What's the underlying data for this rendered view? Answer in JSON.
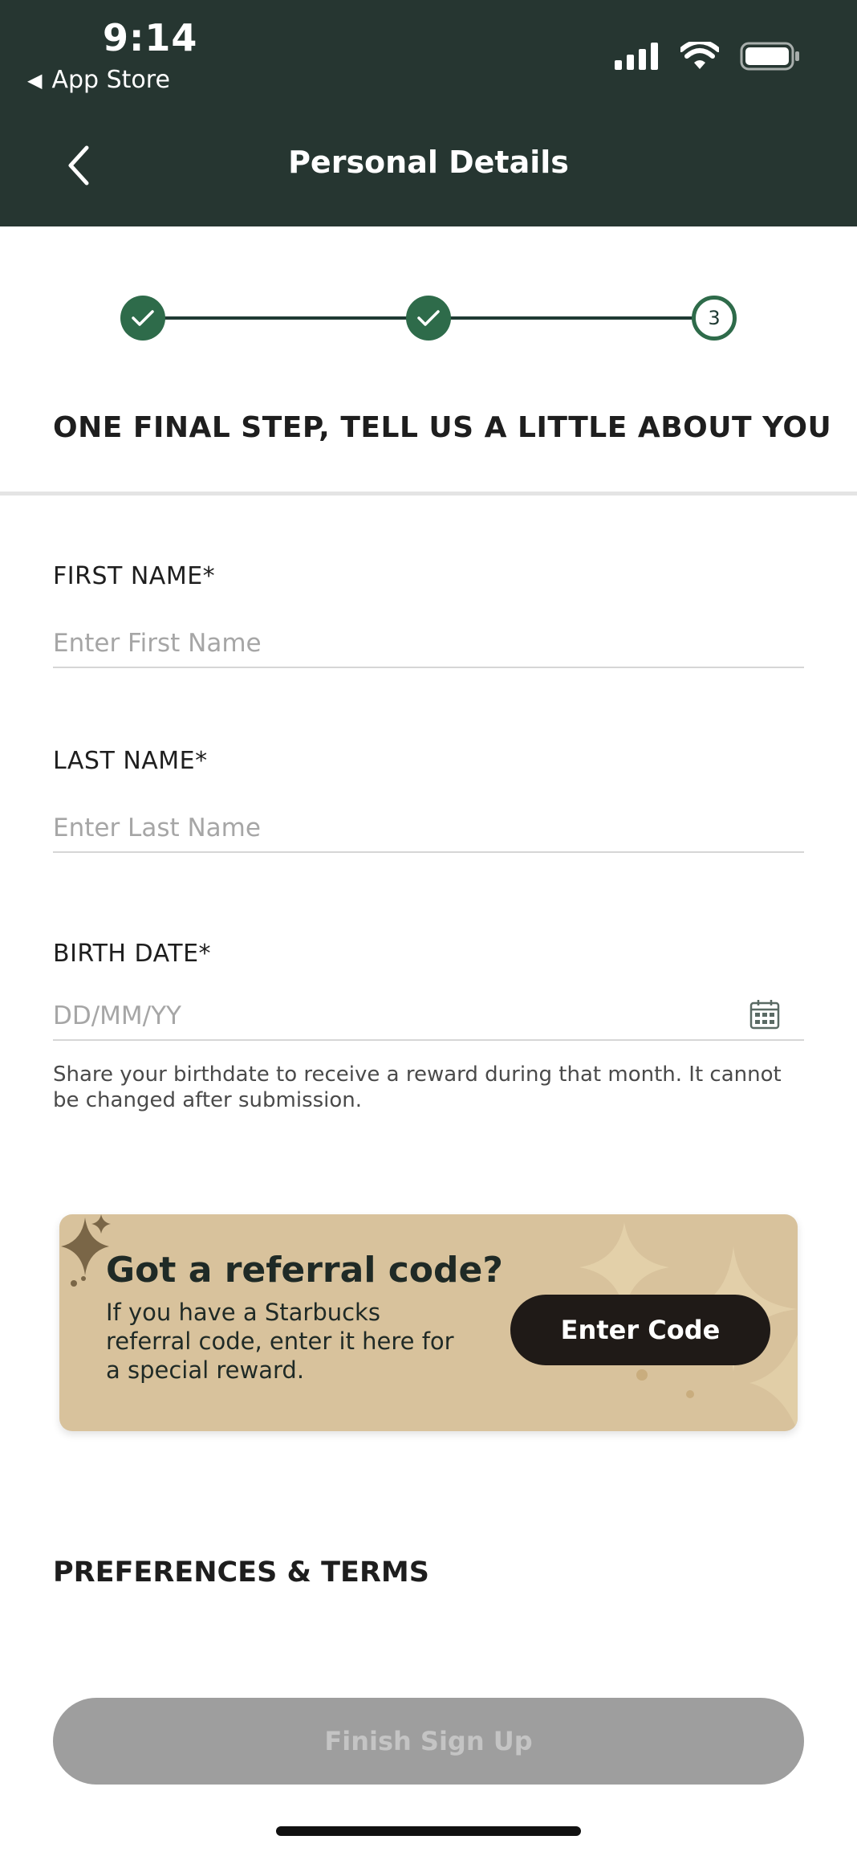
{
  "status_bar": {
    "time": "9:14",
    "back_app": "App Store"
  },
  "header": {
    "title": "Personal Details"
  },
  "stepper": {
    "steps": [
      {
        "state": "done"
      },
      {
        "state": "done"
      },
      {
        "state": "current",
        "label": "3"
      }
    ]
  },
  "form": {
    "heading": "ONE FINAL STEP, TELL US A LITTLE ABOUT YOU",
    "first_name": {
      "label": "FIRST NAME*",
      "placeholder": "Enter First Name",
      "value": ""
    },
    "last_name": {
      "label": "LAST NAME*",
      "placeholder": "Enter Last Name",
      "value": ""
    },
    "birth_date": {
      "label": "BIRTH DATE*",
      "placeholder": "DD/MM/YY",
      "value": "",
      "help": "Share your birthdate to receive a reward during that month. It cannot be changed after submission."
    }
  },
  "referral": {
    "title": "Got a referral code?",
    "body": "If you have a Starbucks referral code, enter it here for a special reward.",
    "button": "Enter Code"
  },
  "preferences": {
    "heading": "PREFERENCES & TERMS"
  },
  "finish": {
    "label": "Finish Sign Up"
  },
  "colors": {
    "header_bg": "#263631",
    "accent_green": "#2e6b4a",
    "card_bg": "#d8c29c",
    "disabled_button": "#9e9e9e"
  },
  "icons": [
    "chevron-left-icon",
    "cellular-signal-icon",
    "wifi-icon",
    "battery-icon",
    "checkmark-icon",
    "calendar-icon",
    "sparkle-icon"
  ]
}
